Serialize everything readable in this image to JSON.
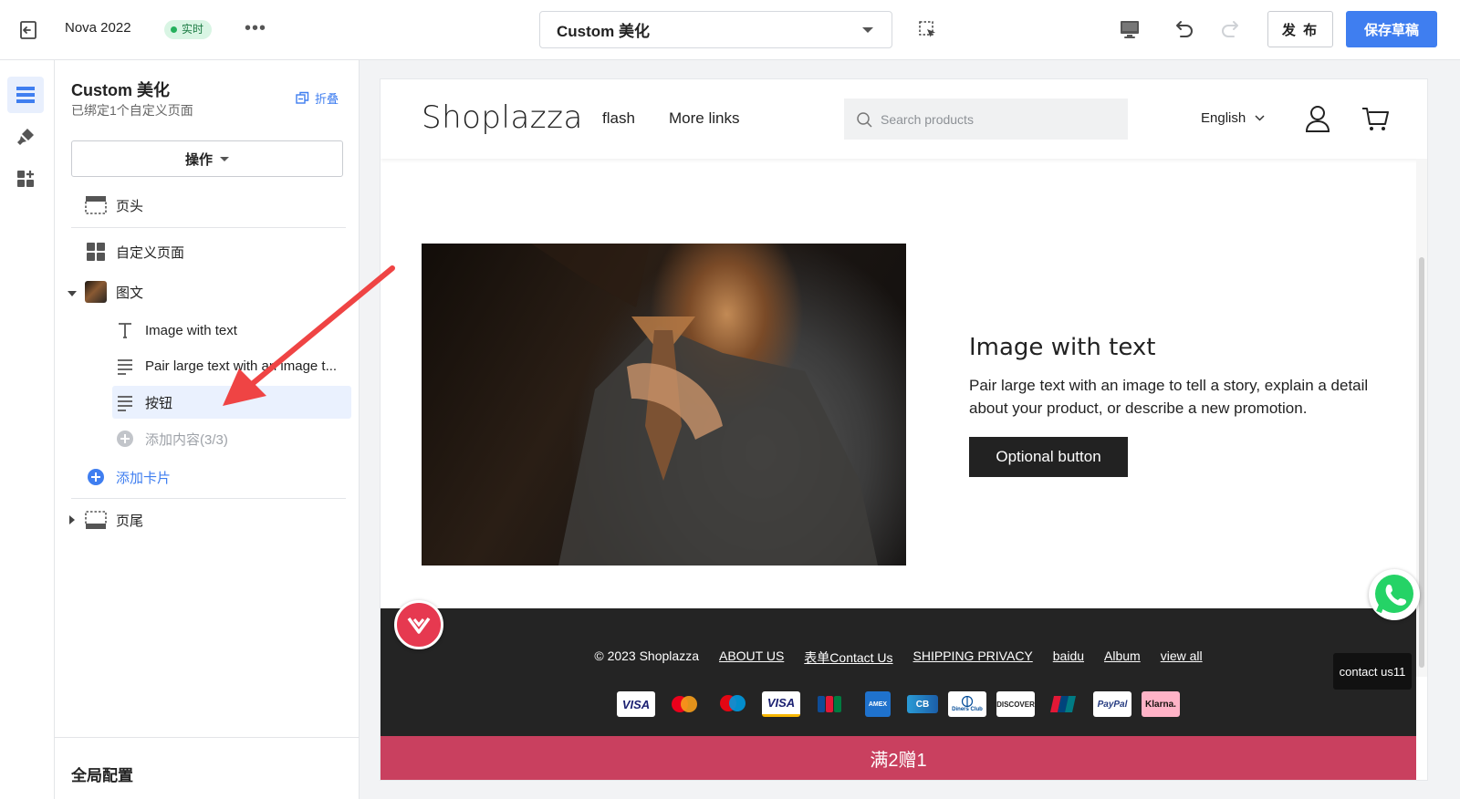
{
  "topbar": {
    "theme_name": "Nova 2022",
    "status_badge": "实时",
    "more": "•••",
    "page_select": "Custom 美化",
    "publish": "发 布",
    "save_draft": "保存草稿"
  },
  "sidebar": {
    "title": "Custom 美化",
    "subtitle": "已绑定1个自定义页面",
    "collapse": "折叠",
    "operations": "操作",
    "items": {
      "header": "页头",
      "custom_page": "自定义页面",
      "image_text": "图文",
      "child_title": "Image with text",
      "child_desc": "Pair large text with an image t...",
      "child_button": "按钮",
      "add_content": "添加内容(3/3)",
      "add_card": "添加卡片",
      "footer": "页尾"
    },
    "global_config": "全局配置"
  },
  "preview": {
    "logo": "Shoplazza",
    "nav": [
      "flash",
      "More links"
    ],
    "search_placeholder": "Search products",
    "language": "English",
    "section": {
      "heading": "Image with text",
      "text": "Pair large text with an image to tell a story, explain a detail about your product, or describe a new promotion.",
      "button": "Optional button"
    },
    "footer": {
      "copyright": "© 2023 Shoplazza",
      "links": [
        "ABOUT US",
        "表单Contact Us",
        "SHIPPING PRIVACY",
        "baidu",
        "Album",
        "view all"
      ],
      "payments": [
        "VISA",
        "Mastercard",
        "Maestro",
        "VISA",
        "JCB",
        "AMEX",
        "CB",
        "Diners Club",
        "DISCOVER",
        "UnionPay",
        "PayPal",
        "Klarna."
      ]
    },
    "banner": "满2赠1",
    "contact_chip": "contact us11"
  },
  "colors": {
    "accent": "#3f7ef0",
    "banner": "#c9405f",
    "footer": "#242424",
    "annotation_arrow": "#ef4444"
  }
}
